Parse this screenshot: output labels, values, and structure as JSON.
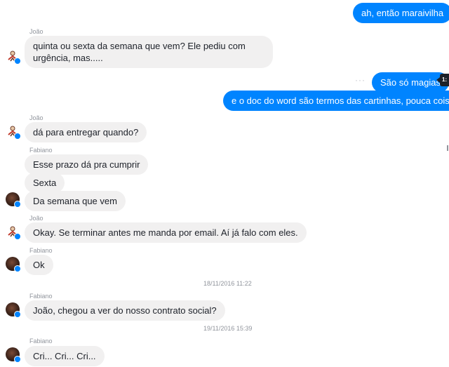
{
  "messages": {
    "m1": {
      "text": "ah, então maraivilha"
    },
    "m2": {
      "sender": "João",
      "text": "quinta ou sexta da semana que vem? Ele pediu com urgência, mas....."
    },
    "m3": {
      "text": "São só magias"
    },
    "m4": {
      "text": "e o doc do word são termos das cartinhas, pouca coisa"
    },
    "m5": {
      "sender": "João",
      "text": "dá para entregar quando?"
    },
    "m6": {
      "sender": "Fabiano",
      "text": "Esse prazo dá pra cumprir"
    },
    "m7": {
      "text": "Sexta"
    },
    "m8": {
      "text": "Da semana que vem"
    },
    "m9": {
      "sender": "João",
      "text": "Okay. Se terminar antes me manda por email. Aí já falo com eles."
    },
    "m10": {
      "sender": "Fabiano",
      "text": "Ok"
    },
    "m11": {
      "sender": "Fabiano",
      "text": "João, chegou a ver do nosso contrato social?"
    },
    "m12": {
      "sender": "Fabiano",
      "text": "Cri... Cri... Cri..."
    }
  },
  "timestamps": {
    "t1": "18/11/2016 11:22",
    "t2": "19/11/2016 15:39"
  },
  "ui": {
    "more_dots": "···",
    "tooltip_text": "1:"
  },
  "colors": {
    "outgoing_bubble": "#0084ff",
    "incoming_bubble": "#f1f0f0",
    "meta_text": "#90949c"
  },
  "icons": {
    "joao_avatar": "stick-figure-avatar-icon",
    "fabiano_avatar": "photo-avatar-icon",
    "messenger_badge": "messenger-badge-icon"
  }
}
